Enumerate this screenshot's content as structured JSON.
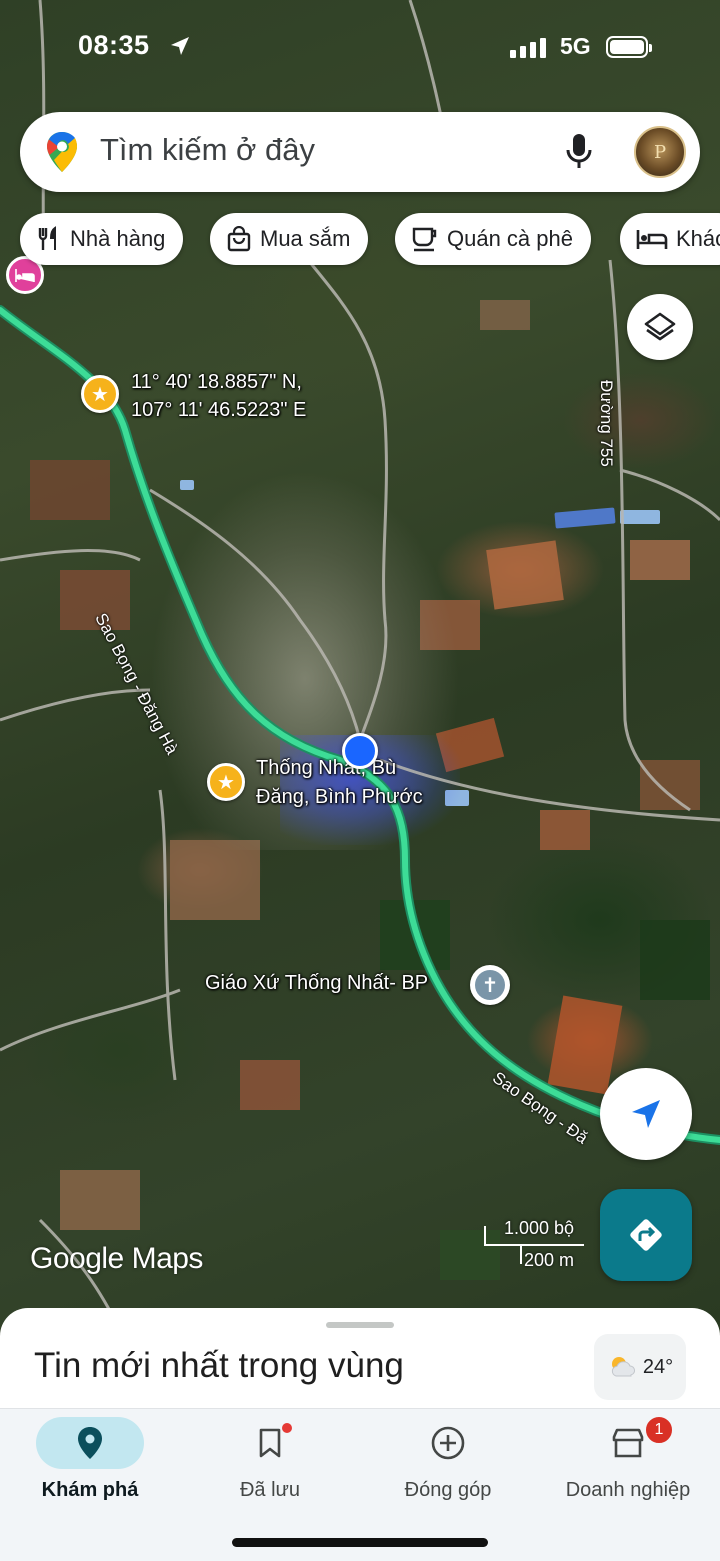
{
  "status_bar": {
    "time": "08:35",
    "network": "5G"
  },
  "search": {
    "placeholder": "Tìm kiếm ở đây"
  },
  "chips": [
    {
      "label": "Nhà hàng",
      "icon": "fork-knife-icon"
    },
    {
      "label": "Mua sắm",
      "icon": "shopping-bag-icon"
    },
    {
      "label": "Quán cà phê",
      "icon": "coffee-cup-icon"
    },
    {
      "label": "Khác",
      "icon": "bed-icon"
    }
  ],
  "map": {
    "coordinates_line1": "11° 40' 18.8857\" N,",
    "coordinates_line2": "107° 11' 46.5223\" E",
    "place_line1": "Thống Nhất, Bù",
    "place_line2": "Đăng, Bình Phước",
    "church_label": "Giáo Xứ Thống Nhất- BP",
    "road_sao_bong_dang_ha": "Sao Bọng - Đăng Hà",
    "road_sao_bong_lower": "Sao Bọng - Đă",
    "road_755": "Đường 755",
    "logo": "Google Maps",
    "scale_feet": "1.000 bộ",
    "scale_meters": "200 m",
    "route_color": "#3ddc97",
    "location_dot_color": "#1a66ff"
  },
  "sheet": {
    "title": "Tin mới nhất trong vùng",
    "weather": "24°",
    "weather_icon": "partly-cloudy-icon"
  },
  "nav": [
    {
      "label": "Khám phá",
      "icon": "location-pin-icon",
      "active": true
    },
    {
      "label": "Đã lưu",
      "icon": "bookmark-icon",
      "badge_dot": true
    },
    {
      "label": "Đóng góp",
      "icon": "add-circle-icon"
    },
    {
      "label": "Doanh nghiệp",
      "icon": "storefront-icon",
      "badge": "1"
    }
  ],
  "colors": {
    "accent_teal": "#0b7a8b",
    "active_nav_bg": "#c2e7f0",
    "star_pin": "#f6b21b"
  }
}
